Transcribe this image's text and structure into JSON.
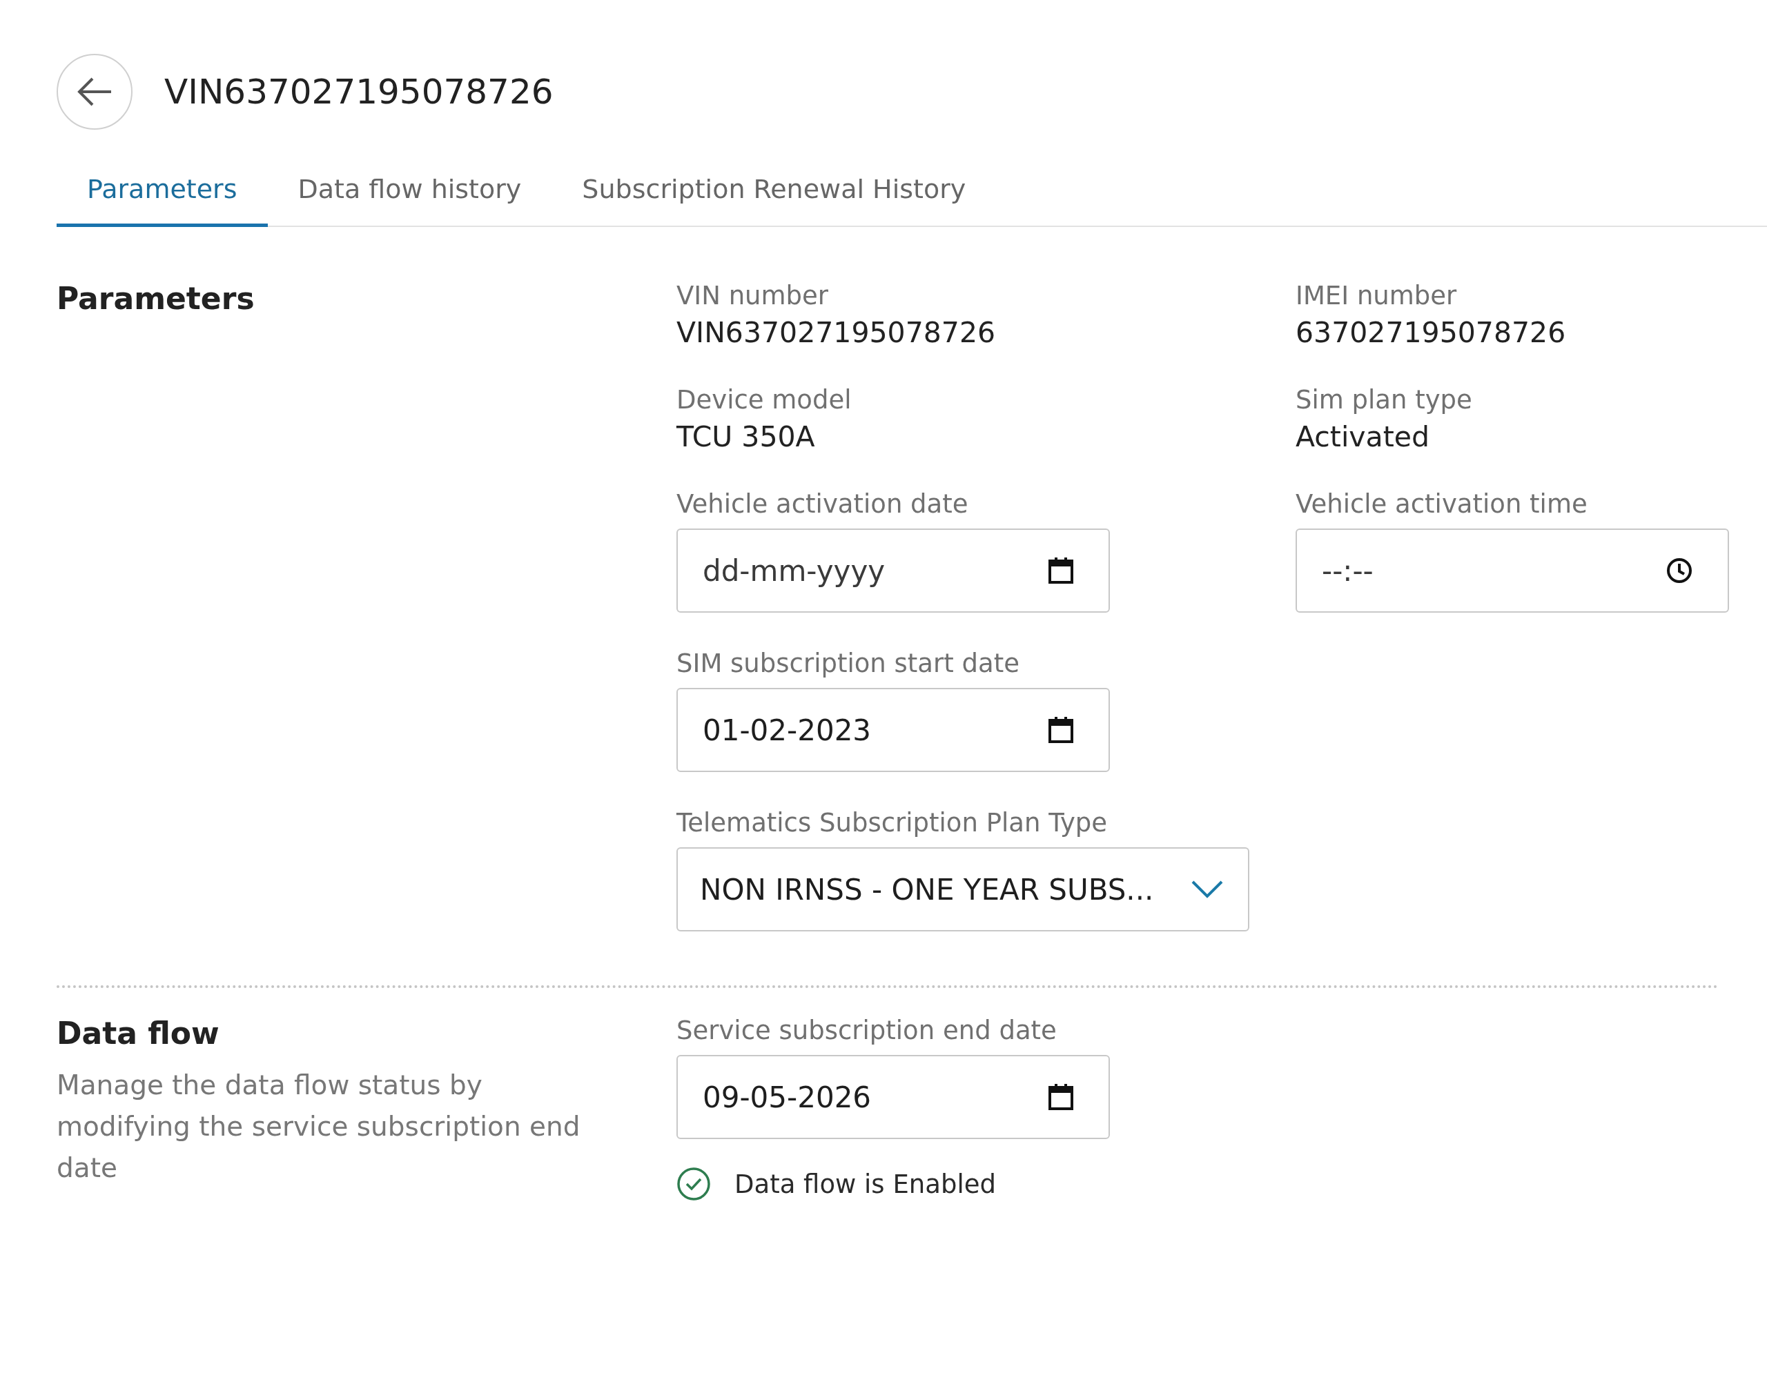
{
  "header": {
    "title": "VIN637027195078726"
  },
  "tabs": [
    {
      "label": "Parameters",
      "selected": true
    },
    {
      "label": "Data flow history",
      "selected": false
    },
    {
      "label": "Subscription Renewal History",
      "selected": false
    }
  ],
  "parameters": {
    "heading": "Parameters",
    "rows": [
      [
        {
          "kind": "text",
          "label": "VIN number",
          "value": "VIN637027195078726"
        },
        {
          "kind": "text",
          "label": "IMEI number",
          "value": "637027195078726"
        }
      ],
      [
        {
          "kind": "text",
          "label": "Device model",
          "value": "TCU 350A"
        },
        {
          "kind": "text",
          "label": "Sim plan type",
          "value": "Activated"
        }
      ],
      [
        {
          "kind": "date",
          "label": "Vehicle activation date",
          "placeholder": "dd-mm-yyyy"
        },
        {
          "kind": "time",
          "label": "Vehicle activation time",
          "placeholder": "--:--"
        }
      ],
      [
        {
          "kind": "date",
          "label": "SIM subscription start date",
          "value": "01-02-2023"
        }
      ],
      [
        {
          "kind": "select",
          "label": "Telematics Subscription Plan Type",
          "value": "NON IRNSS - ONE YEAR SUBS..."
        }
      ]
    ]
  },
  "data_flow": {
    "heading": "Data flow",
    "description": "Manage the data flow status by modifying the service subscription end date",
    "field": {
      "kind": "date",
      "label": "Service subscription end date",
      "value": "09-05-2026"
    },
    "status": {
      "text": "Data flow is Enabled",
      "enabled": true
    }
  }
}
